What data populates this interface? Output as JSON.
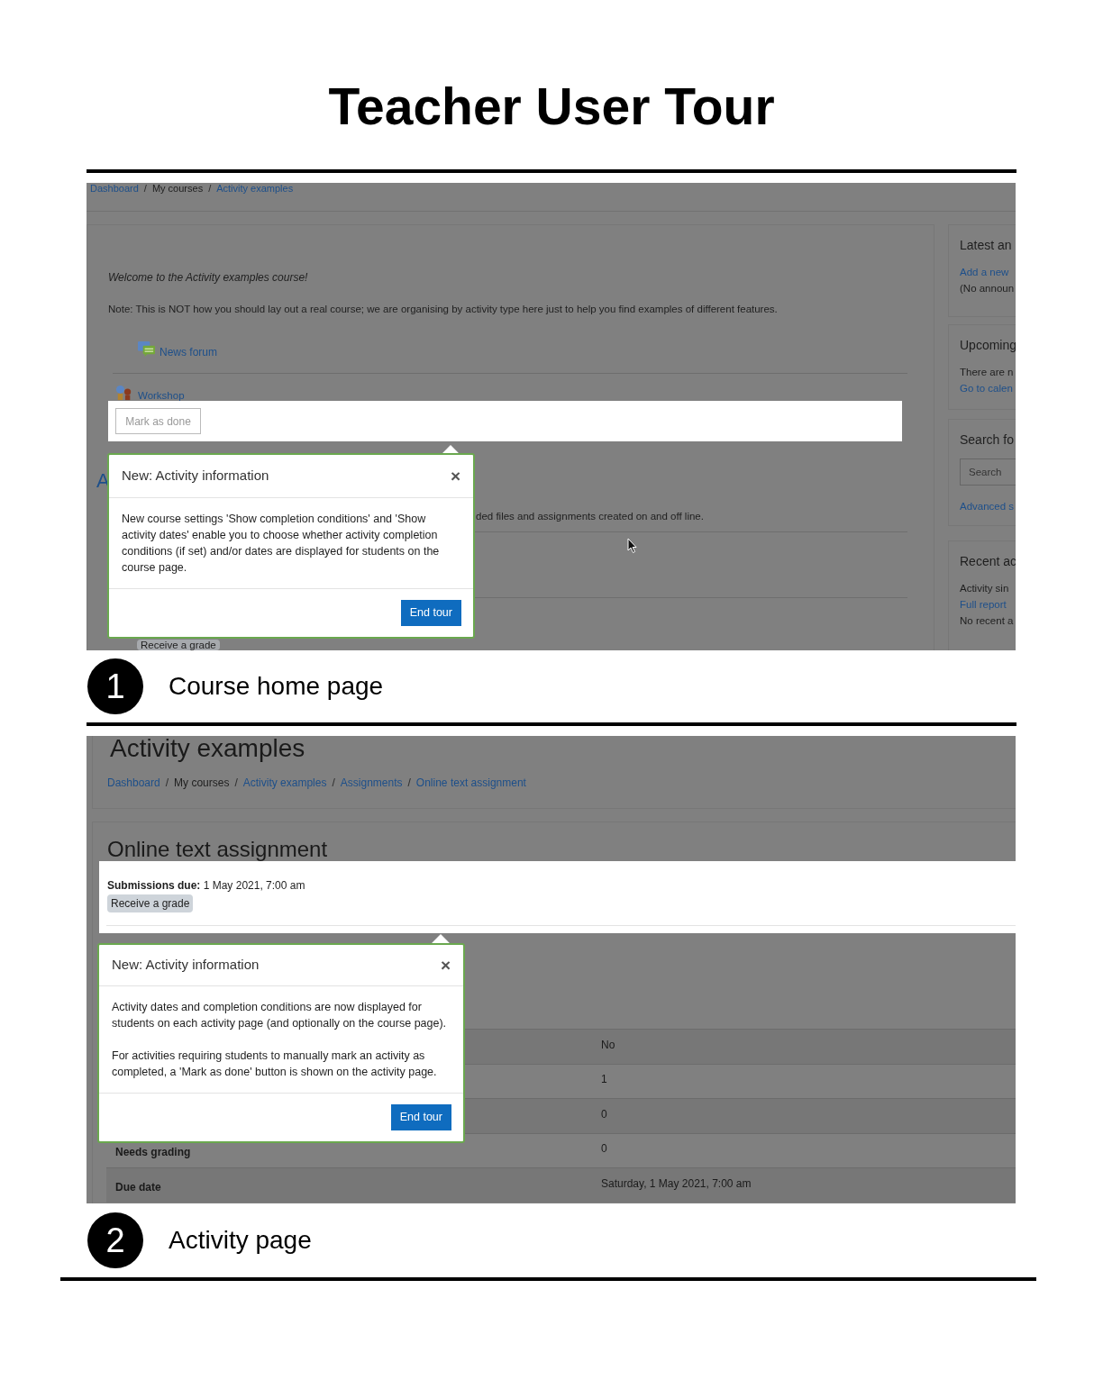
{
  "title": "Teacher User Tour",
  "course_page": {
    "breadcrumb": {
      "separator": "/",
      "items": [
        {
          "label": "Dashboard",
          "link": true
        },
        {
          "label": "My courses",
          "link": false
        },
        {
          "label": "Activity examples",
          "link": true
        }
      ]
    },
    "welcome": "Welcome to the Activity examples course!",
    "note": "Note: This is NOT how you should lay out a real course; we are organising by activity type here just to help you find examples of different features.",
    "activities": [
      {
        "name": "News forum",
        "kind": "forum"
      },
      {
        "name": "Workshop",
        "kind": "workshop"
      }
    ],
    "mark_button": "Mark as done",
    "section_heading": "A",
    "partial_text": "ded files and assignments created on and off line.",
    "badge": "Receive a grade",
    "blocks": [
      {
        "title": "Latest an",
        "lines": [
          {
            "kind": "link",
            "text": "Add a new"
          },
          {
            "kind": "text",
            "text": "(No announ"
          }
        ]
      },
      {
        "title": "Upcoming",
        "lines": [
          {
            "kind": "text",
            "text": "There are n"
          },
          {
            "kind": "link",
            "text": "Go to calen"
          }
        ]
      },
      {
        "title": "Search fo",
        "lines": [
          {
            "kind": "field",
            "placeholder": "Search"
          },
          {
            "kind": "link",
            "text": "Advanced s"
          }
        ]
      },
      {
        "title": "Recent ac",
        "lines": [
          {
            "kind": "text",
            "text": "Activity sin"
          },
          {
            "kind": "link",
            "text": "Full report"
          },
          {
            "kind": "text",
            "text": "No recent a"
          }
        ]
      }
    ],
    "tour": {
      "title": "New: Activity information",
      "close": "×",
      "paragraphs": [
        "New course settings 'Show completion conditions' and 'Show activity dates' enable you to choose whether activity completion conditions (if set) and/or dates are displayed for students on the course page."
      ],
      "button": "End tour"
    }
  },
  "course_caption": {
    "number": "1",
    "text": "Course home page"
  },
  "activity_page": {
    "heading": "Activity examples",
    "breadcrumb": {
      "separator": "/",
      "items": [
        {
          "label": "Dashboard",
          "link": true
        },
        {
          "label": "My courses",
          "link": false
        },
        {
          "label": "Activity examples",
          "link": true
        },
        {
          "label": "Assignments",
          "link": true
        },
        {
          "label": "Online text assignment",
          "link": true
        }
      ]
    },
    "assignment_title": "Online text assignment",
    "submissions_due": "**Submissions due:** 1 May 2021, 7:00 am",
    "badge": "Receive a grade",
    "tour": {
      "title": "New: Activity information",
      "close": "×",
      "paragraphs": [
        "Activity dates and completion conditions are now displayed for students on each activity page (and optionally on the course page).",
        "For activities requiring students to manually mark an activity as completed, a 'Mark as done' button is shown on the activity page."
      ],
      "button": "End tour"
    },
    "table_rows": [
      {
        "value": "No"
      },
      {
        "value": "1"
      },
      {
        "value": "0"
      },
      {
        "label": "Needs grading",
        "value": "0"
      },
      {
        "label": "Due date",
        "value": "Saturday, 1 May 2021, 7:00 am"
      }
    ]
  },
  "activity_caption": {
    "number": "2",
    "text": "Activity page"
  }
}
